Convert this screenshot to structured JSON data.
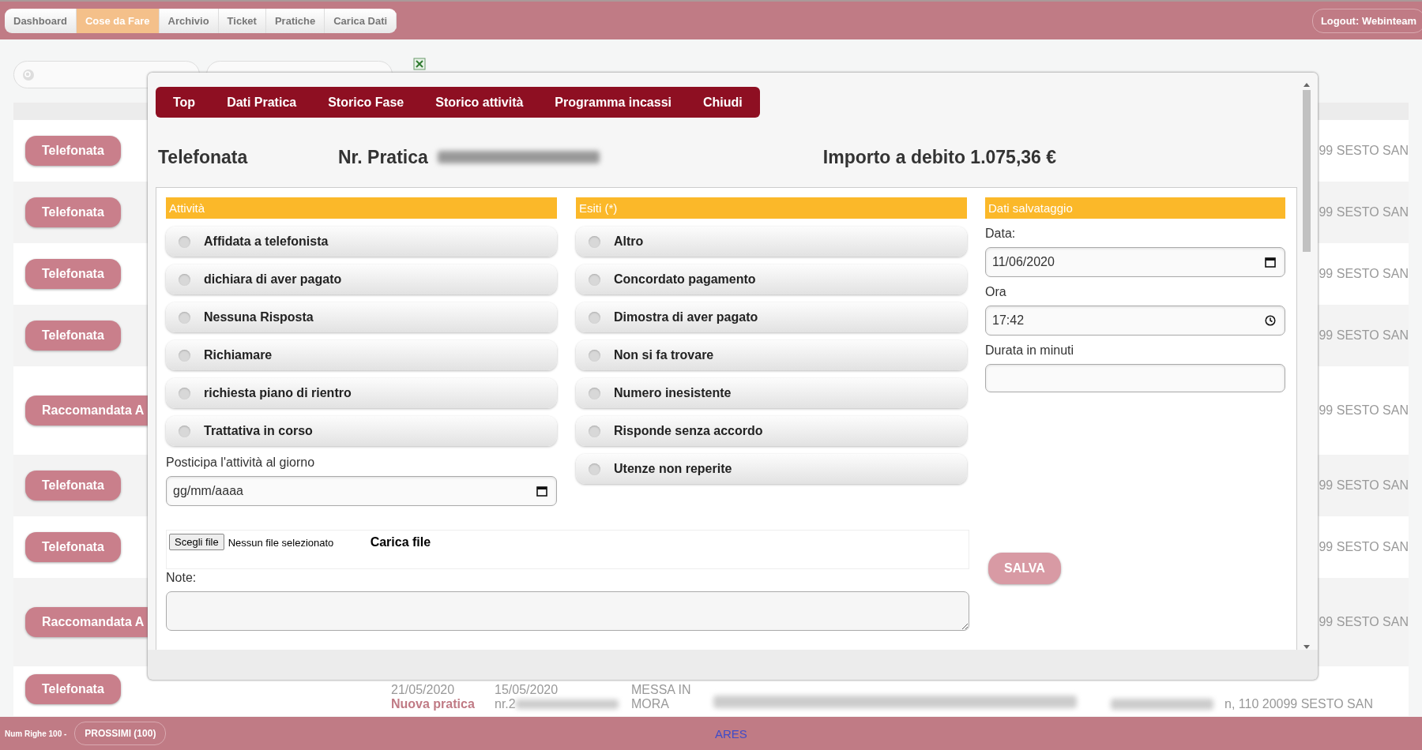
{
  "nav": {
    "tabs": [
      {
        "label": "Dashboard",
        "selected": false
      },
      {
        "label": "Cose da Fare",
        "selected": true
      },
      {
        "label": "Archivio",
        "selected": false
      },
      {
        "label": "Ticket",
        "selected": false
      },
      {
        "label": "Pratiche",
        "selected": false
      },
      {
        "label": "Carica Dati",
        "selected": false
      }
    ],
    "logout": "Logout: Webinteam"
  },
  "background_rows": [
    {
      "kind": "phone",
      "action": "Telefonata",
      "address": "99 SESTO SAN"
    },
    {
      "kind": "phone",
      "action": "Telefonata",
      "address": "99 SESTO SAN"
    },
    {
      "kind": "phone",
      "action": "Telefonata",
      "address": "99 SESTO SAN"
    },
    {
      "kind": "phone",
      "action": "Telefonata",
      "address": "99 SESTO SAN"
    },
    {
      "kind": "letter",
      "action": "Raccomandata A",
      "address": "99 SESTO SAN"
    },
    {
      "kind": "phone",
      "action": "Telefonata",
      "address": "99 SESTO SAN"
    },
    {
      "kind": "phone",
      "action": "Telefonata",
      "address": "99 SESTO SAN"
    },
    {
      "kind": "letter",
      "action": "Raccomandata A",
      "address": "99 SESTO SAN"
    },
    {
      "kind": "detail",
      "action": "Telefonata",
      "date": "21/05/2020",
      "note": "Nuova pratica",
      "date_2": "15/05/2020",
      "number": "nr.2",
      "phase": "MESSA IN MORA",
      "address": "n, 110 20099 SESTO SAN"
    }
  ],
  "modal": {
    "tabs": [
      "Top",
      "Dati Pratica",
      "Storico Fase",
      "Storico attività",
      "Programma incassi",
      "Chiudi"
    ],
    "title": "Telefonata",
    "practice_label": "Nr. Pratica",
    "amount": "Importo a debito 1.075,36 €",
    "activities": {
      "header": "Attività",
      "options": [
        {
          "label": "Affidata a telefonista",
          "selected": false
        },
        {
          "label": "dichiara di aver pagato",
          "selected": false
        },
        {
          "label": "Nessuna Risposta",
          "selected": false
        },
        {
          "label": "Richiamare",
          "selected": false
        },
        {
          "label": "richiesta piano di rientro",
          "selected": false
        },
        {
          "label": "Trattativa in corso",
          "selected": false
        }
      ]
    },
    "postpone": {
      "label": "Posticipa l'attività al giorno",
      "placeholder": "gg/mm/aaaa"
    },
    "outcomes": {
      "header": "Esiti (*)",
      "options": [
        {
          "label": "Altro",
          "selected": false
        },
        {
          "label": "Concordato pagamento",
          "selected": false
        },
        {
          "label": "Dimostra di aver pagato",
          "selected": false
        },
        {
          "label": "Non si fa trovare",
          "selected": false
        },
        {
          "label": "Numero inesistente",
          "selected": false
        },
        {
          "label": "Risponde senza accordo",
          "selected": false
        },
        {
          "label": "Utenze non reperite",
          "selected": false
        }
      ]
    },
    "save": {
      "header": "Dati salvataggio",
      "date_label": "Data:",
      "date": "11/06/2020",
      "time_label": "Ora",
      "time": "17:42",
      "duration_label": "Durata in minuti",
      "button": "SALVA"
    },
    "file": {
      "button": "Scegli file",
      "status": "Nessun file selezionato",
      "upload": "Carica file"
    },
    "notes_label": "Note:"
  },
  "footer": {
    "rows_label": "Num Righe 100 -",
    "next": "PROSSIMI (100)",
    "brand": "ARES"
  }
}
